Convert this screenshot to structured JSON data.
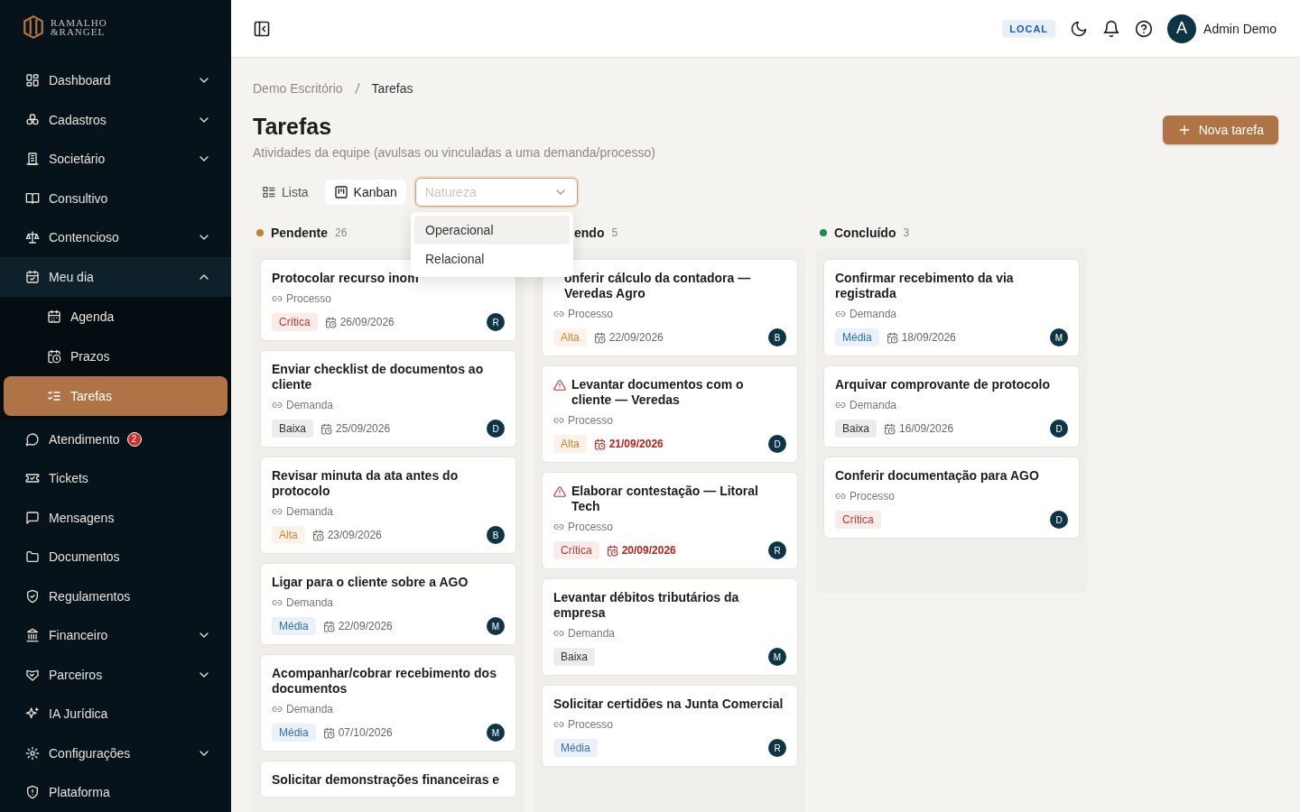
{
  "brand": {
    "line1": "RAMALHO",
    "line2": "&RANGEL"
  },
  "sidebar": {
    "items": [
      {
        "label": "Dashboard",
        "chevron": true,
        "expanded": false,
        "selected": false
      },
      {
        "label": "Cadastros",
        "chevron": true,
        "expanded": false,
        "selected": false
      },
      {
        "label": "Societário",
        "chevron": true,
        "expanded": false,
        "selected": false
      },
      {
        "label": "Consultivo",
        "chevron": false,
        "expanded": false,
        "selected": false
      },
      {
        "label": "Contencioso",
        "chevron": true,
        "expanded": false,
        "selected": false
      },
      {
        "label": "Meu dia",
        "chevron": true,
        "expanded": true,
        "selected": false,
        "children": [
          {
            "label": "Agenda",
            "selected": false
          },
          {
            "label": "Prazos",
            "selected": false
          },
          {
            "label": "Tarefas",
            "selected": true
          }
        ]
      },
      {
        "label": "Atendimento",
        "chevron": false,
        "expanded": false,
        "selected": false,
        "badge": "2"
      },
      {
        "label": "Tickets",
        "chevron": false,
        "expanded": false,
        "selected": false
      },
      {
        "label": "Mensagens",
        "chevron": false,
        "expanded": false,
        "selected": false
      },
      {
        "label": "Documentos",
        "chevron": false,
        "expanded": false,
        "selected": false
      },
      {
        "label": "Regulamentos",
        "chevron": false,
        "expanded": false,
        "selected": false
      },
      {
        "label": "Financeiro",
        "chevron": true,
        "expanded": false,
        "selected": false
      },
      {
        "label": "Parceiros",
        "chevron": true,
        "expanded": false,
        "selected": false
      },
      {
        "label": "IA Jurídica",
        "chevron": false,
        "expanded": false,
        "selected": false
      },
      {
        "label": "Configurações",
        "chevron": true,
        "expanded": false,
        "selected": false
      },
      {
        "label": "Plataforma",
        "chevron": false,
        "expanded": false,
        "selected": false
      }
    ]
  },
  "topbar": {
    "env": "LOCAL",
    "avatar": "A",
    "user": "Admin Demo"
  },
  "breadcrumb": [
    "Demo Escritório",
    "Tarefas"
  ],
  "title": "Tarefas",
  "subtitle": "Atividades da equipe (avulsas ou vinculadas a uma demanda/processo)",
  "new_button": "Nova tarefa",
  "view_tabs": [
    {
      "label": "Lista",
      "selected": false
    },
    {
      "label": "Kanban",
      "selected": true
    }
  ],
  "filter": {
    "placeholder": "Natureza",
    "open": true,
    "options": [
      {
        "label": "Operacional",
        "selected": true
      },
      {
        "label": "Relacional",
        "selected": false
      }
    ]
  },
  "columns": [
    {
      "title": "Pendente",
      "count": "26",
      "color": "#c0812f",
      "covered_start": false,
      "cards": [
        {
          "title": "Protocolar recurso inom",
          "covered_start": false,
          "alert": false,
          "link": "Processo",
          "priority": {
            "label": "Crítica",
            "color": "#c0392b"
          },
          "due": "26/09/2026",
          "overdue": false,
          "assignee": "R"
        },
        {
          "title": "Enviar checklist de documentos ao cliente",
          "covered_start": false,
          "alert": false,
          "link": "Demanda",
          "priority": {
            "label": "Baixa",
            "color": "#333333"
          },
          "due": "25/09/2026",
          "overdue": false,
          "assignee": "D"
        },
        {
          "title": "Revisar minuta da ata antes do protocolo",
          "covered_start": false,
          "alert": false,
          "link": "Demanda",
          "priority": {
            "label": "Alta",
            "color": "#d9822b"
          },
          "due": "23/09/2026",
          "overdue": false,
          "assignee": "B"
        },
        {
          "title": "Ligar para o cliente sobre a AGO",
          "covered_start": false,
          "alert": false,
          "link": "Demanda",
          "priority": {
            "label": "Média",
            "color": "#2f6fb5"
          },
          "due": "22/09/2026",
          "overdue": false,
          "assignee": "M"
        },
        {
          "title": "Acompanhar/cobrar recebimento dos documentos",
          "covered_start": false,
          "alert": false,
          "link": "Demanda",
          "priority": {
            "label": "Média",
            "color": "#2f6fb5"
          },
          "due": "07/10/2026",
          "overdue": false,
          "assignee": "M"
        },
        {
          "title": "Solicitar demonstrações financeiras e",
          "covered_start": false,
          "alert": false
        }
      ]
    },
    {
      "title": "endo",
      "count": "5",
      "covered_start": true,
      "cards": [
        {
          "title": "onferir cálculo da contadora — Veredas Agro",
          "covered_start": true,
          "alert": false,
          "link": "Processo",
          "priority": {
            "label": "Alta",
            "color": "#d9822b"
          },
          "due": "22/09/2026",
          "overdue": false,
          "assignee": "B"
        },
        {
          "title": "Levantar documentos com o cliente — Veredas",
          "covered_start": false,
          "alert": true,
          "link": "Processo",
          "priority": {
            "label": "Alta",
            "color": "#d9822b"
          },
          "due": "21/09/2026",
          "overdue": true,
          "assignee": "D"
        },
        {
          "title": "Elaborar contestação — Litoral Tech",
          "covered_start": false,
          "alert": true,
          "link": "Processo",
          "priority": {
            "label": "Crítica",
            "color": "#c0392b"
          },
          "due": "20/09/2026",
          "overdue": true,
          "assignee": "R"
        },
        {
          "title": "Levantar débitos tributários da empresa",
          "covered_start": false,
          "alert": false,
          "link": "Demanda",
          "priority": {
            "label": "Baixa",
            "color": "#333333"
          },
          "assignee": "M"
        },
        {
          "title": "Solicitar certidões na Junta Comercial",
          "covered_start": false,
          "alert": false,
          "link": "Processo",
          "priority": {
            "label": "Média",
            "color": "#2f6fb5"
          },
          "assignee": "R"
        }
      ]
    },
    {
      "title": "Concluído",
      "count": "3",
      "color": "#1e8a4c",
      "covered_start": false,
      "cards": [
        {
          "title": "Confirmar recebimento da via registrada",
          "covered_start": false,
          "alert": false,
          "link": "Demanda",
          "priority": {
            "label": "Média",
            "color": "#2f6fb5"
          },
          "due": "18/09/2026",
          "overdue": false,
          "assignee": "M"
        },
        {
          "title": "Arquivar comprovante de protocolo",
          "covered_start": false,
          "alert": false,
          "link": "Demanda",
          "priority": {
            "label": "Baixa",
            "color": "#333333"
          },
          "due": "16/09/2026",
          "overdue": false,
          "assignee": "D"
        },
        {
          "title": "Conferir documentação para AGO",
          "covered_start": false,
          "alert": false,
          "link": "Processo",
          "priority": {
            "label": "Crítica",
            "color": "#c0392b"
          },
          "assignee": "D"
        }
      ]
    }
  ]
}
